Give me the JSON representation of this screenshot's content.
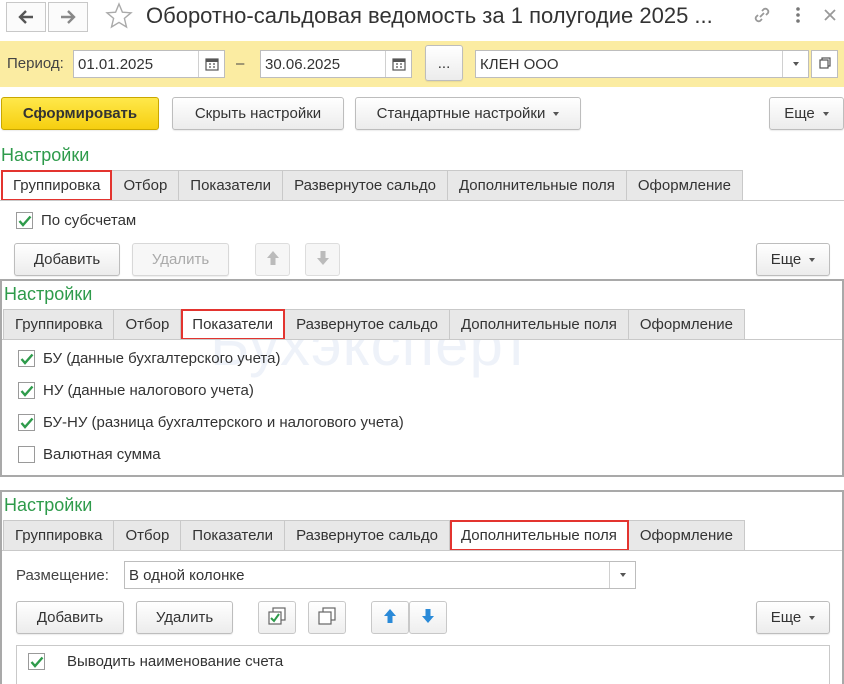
{
  "window": {
    "title": "Оборотно-сальдовая ведомость за 1 полугодие 2025 ...",
    "icons": [
      "arrow-left-icon",
      "arrow-right-icon",
      "star-icon",
      "link-icon",
      "more-vertical-icon",
      "close-icon"
    ]
  },
  "period": {
    "label": "Период:",
    "from": "01.01.2025",
    "dash": "–",
    "to": "30.06.2025",
    "ellipsis": "...",
    "org": "КЛЕН ООО"
  },
  "toolbar": {
    "form": "Сформировать",
    "hide": "Скрыть настройки",
    "standard": "Стандартные настройки",
    "more": "Еще"
  },
  "tab_labels": [
    "Группировка",
    "Отбор",
    "Показатели",
    "Развернутое сальдо",
    "Дополнительные поля",
    "Оформление"
  ],
  "section1": {
    "title": "Настройки",
    "active_tab": 0,
    "checkbox_label": "По субсчетам",
    "checkbox_checked": true,
    "add": "Добавить",
    "delete": "Удалить",
    "more": "Еще"
  },
  "section2": {
    "title": "Настройки",
    "active_tab": 2,
    "items": [
      {
        "label": "БУ (данные бухгалтерского учета)",
        "checked": true
      },
      {
        "label": "НУ (данные налогового учета)",
        "checked": true
      },
      {
        "label": "БУ-НУ (разница бухгалтерского и налогового учета)",
        "checked": true
      },
      {
        "label": "Валютная сумма",
        "checked": false
      }
    ]
  },
  "section3": {
    "title": "Настройки",
    "active_tab": 4,
    "placement_label": "Размещение:",
    "placement_value": "В одной колонке",
    "add": "Добавить",
    "delete": "Удалить",
    "more": "Еще",
    "row_label": "Выводить наименование счета",
    "row_checked": true
  },
  "watermark": "Бухэксперт",
  "colors": {
    "accent_green": "#2e9b4b",
    "highlight_red": "#e3342f",
    "period_bar": "#fbeca2",
    "primary_button": "#f6cf10",
    "arrow_blue": "#2a8ad8"
  }
}
